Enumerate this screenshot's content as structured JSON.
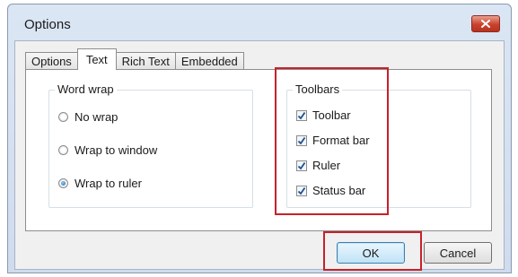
{
  "dialog": {
    "title": "Options"
  },
  "tabs": [
    {
      "label": "Options",
      "active": false
    },
    {
      "label": "Text",
      "active": true
    },
    {
      "label": "Rich Text",
      "active": false
    },
    {
      "label": "Embedded",
      "active": false
    }
  ],
  "word_wrap": {
    "label": "Word wrap",
    "options": [
      {
        "label": "No wrap",
        "selected": false
      },
      {
        "label": "Wrap to window",
        "selected": false
      },
      {
        "label": "Wrap to ruler",
        "selected": true
      }
    ]
  },
  "toolbars": {
    "label": "Toolbars",
    "items": [
      {
        "label": "Toolbar",
        "checked": true
      },
      {
        "label": "Format bar",
        "checked": true
      },
      {
        "label": "Ruler",
        "checked": true
      },
      {
        "label": "Status bar",
        "checked": true
      }
    ]
  },
  "buttons": {
    "ok": "OK",
    "cancel": "Cancel"
  },
  "colors": {
    "highlight": "#c8202a",
    "close_button": "#c8412c",
    "check_mark": "#1f4f8f"
  }
}
